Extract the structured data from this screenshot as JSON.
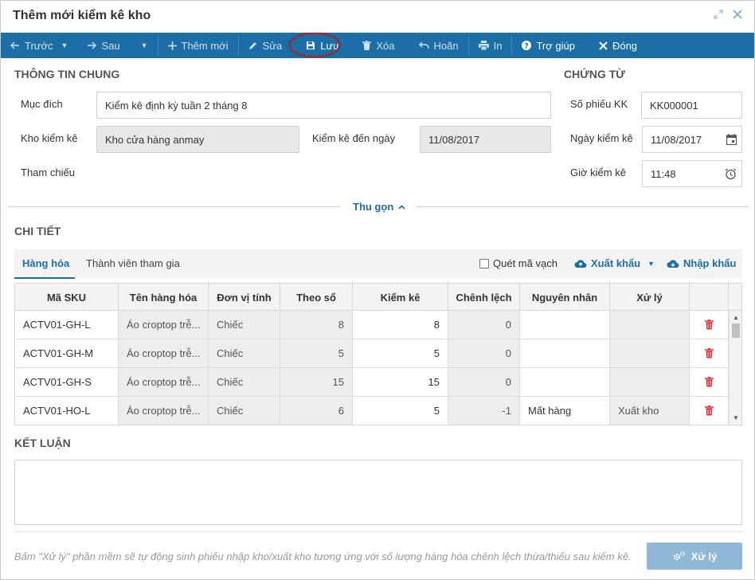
{
  "window": {
    "title": "Thêm mới kiểm kê kho",
    "expand_icon": "expand-arrows-icon",
    "close_icon": "close-icon"
  },
  "toolbar": {
    "prev": "Trước",
    "next": "Sau",
    "add": "Thêm mới",
    "edit": "Sửa",
    "save": "Lưu",
    "delete": "Xóa",
    "undo": "Hoãn",
    "print": "In",
    "help": "Trợ giúp",
    "close": "Đóng",
    "highlight_color": "#b0232a"
  },
  "general": {
    "section_title": "THÔNG TIN CHUNG",
    "purpose_label": "Mục đích",
    "purpose_value": "Kiểm kê định kỳ tuần 2 tháng 8",
    "warehouse_label": "Kho kiểm kê",
    "warehouse_value": "Kho cửa hàng anmay",
    "until_label": "Kiểm kê đến ngày",
    "until_value": "11/08/2017",
    "reference_label": "Tham chiếu"
  },
  "voucher": {
    "section_title": "CHỨNG TỪ",
    "number_label": "Số phiếu KK",
    "number_value": "KK000001",
    "date_label": "Ngày kiểm kê",
    "date_value": "11/08/2017",
    "time_label": "Giờ kiểm kê",
    "time_value": "11:48"
  },
  "collapse_label": "Thu gọn",
  "detail": {
    "section_title": "CHI TIẾT",
    "tabs": [
      {
        "label": "Hàng hóa",
        "active": true
      },
      {
        "label": "Thành viên tham gia",
        "active": false
      }
    ],
    "barcode_label": "Quét mã vạch",
    "export_label": "Xuất khẩu",
    "import_label": "Nhập khẩu",
    "columns": [
      "Mã SKU",
      "Tên hàng hóa",
      "Đơn vị tính",
      "Theo sổ",
      "Kiểm kê",
      "Chênh lệch",
      "Nguyên nhân",
      "Xử lý"
    ],
    "rows": [
      {
        "sku": "ACTV01-GH-L",
        "name": "Áo croptop trễ...",
        "unit": "Chiếc",
        "book": "8",
        "counted": "8",
        "diff": "0",
        "reason": "",
        "action": ""
      },
      {
        "sku": "ACTV01-GH-M",
        "name": "Áo croptop trễ...",
        "unit": "Chiếc",
        "book": "5",
        "counted": "5",
        "diff": "0",
        "reason": "",
        "action": ""
      },
      {
        "sku": "ACTV01-GH-S",
        "name": "Áo croptop trễ...",
        "unit": "Chiếc",
        "book": "15",
        "counted": "15",
        "diff": "0",
        "reason": "",
        "action": ""
      },
      {
        "sku": "ACTV01-HO-L",
        "name": "Áo croptop trễ...",
        "unit": "Chiếc",
        "book": "6",
        "counted": "5",
        "diff": "-1",
        "reason": "Mất hàng",
        "action": "Xuất kho"
      }
    ],
    "delete_icon_color": "#d9363e"
  },
  "conclusion": {
    "section_title": "KẾT LUẬN",
    "value": ""
  },
  "footer": {
    "note": "Bấm \"Xử lý\" phần mềm sẽ tự động sinh phiếu nhập kho/xuất kho tương ứng với số lượng hàng hóa chênh lệch thừa/thiếu sau kiểm kê.",
    "process_label": "Xử lý"
  },
  "colors": {
    "primary": "#1b6ea6",
    "readonly_bg": "#e8e8ea"
  }
}
